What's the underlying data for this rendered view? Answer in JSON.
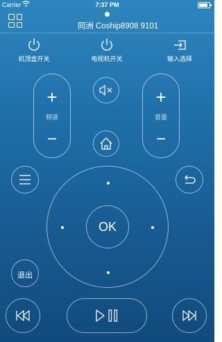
{
  "status_bar": {
    "carrier": "Carrier",
    "time": "7:37 PM",
    "battery_level": 1.0
  },
  "header": {
    "device_name": "同洲 Coship8908 9101"
  },
  "top_buttons": {
    "stb_power": "机顶盒开关",
    "tv_power": "电视机开关",
    "input_select": "输入选择"
  },
  "channel": {
    "label": "频道",
    "plus": "+",
    "minus": "−"
  },
  "volume": {
    "label": "音量",
    "plus": "+",
    "minus": "−"
  },
  "dpad": {
    "ok": "OK"
  },
  "exit_label": "退出",
  "icons": [
    "grid-icon",
    "power-icon",
    "input-icon",
    "mute-icon",
    "home-icon",
    "menu-icon",
    "back-icon",
    "rewind-icon",
    "play-pause-icon",
    "fast-forward-icon"
  ]
}
